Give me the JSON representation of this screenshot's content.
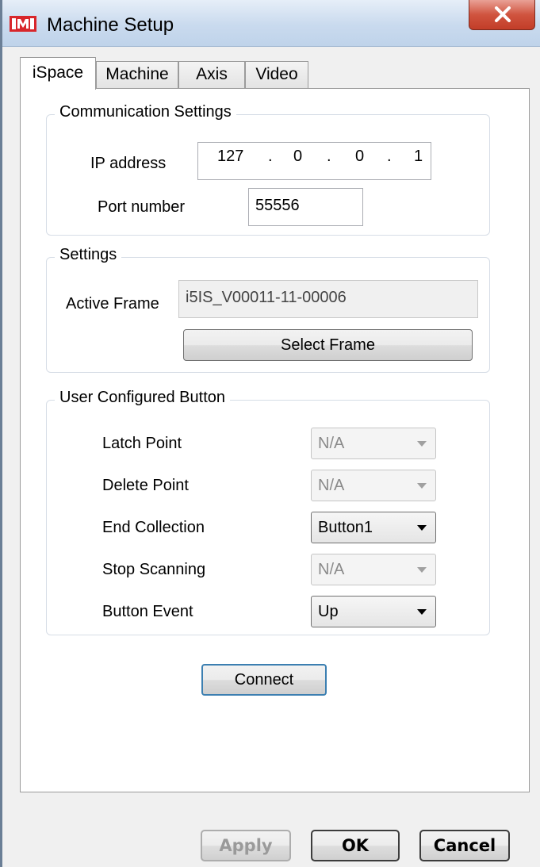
{
  "window": {
    "title": "Machine Setup",
    "icon": "app-logo-icon",
    "close_icon": "close-icon"
  },
  "tabs": [
    {
      "label": "iSpace",
      "active": true
    },
    {
      "label": "Machine",
      "active": false
    },
    {
      "label": "Axis",
      "active": false
    },
    {
      "label": "Video",
      "active": false
    }
  ],
  "communication": {
    "title": "Communication Settings",
    "ip_label": "IP address",
    "ip": {
      "o1": "127",
      "o2": "0",
      "o3": "0",
      "o4": "1"
    },
    "ip_dot": ".",
    "port_label": "Port number",
    "port_value": "55556"
  },
  "settings": {
    "title": "Settings",
    "active_frame_label": "Active Frame",
    "active_frame_value": "i5IS_V00011-11-00006",
    "select_frame_label": "Select Frame"
  },
  "user_button": {
    "title": "User Configured Button",
    "rows": [
      {
        "label": "Latch Point",
        "value": "N/A",
        "enabled": false
      },
      {
        "label": "Delete Point",
        "value": "N/A",
        "enabled": false
      },
      {
        "label": "End Collection",
        "value": "Button1",
        "enabled": true
      },
      {
        "label": "Stop Scanning",
        "value": "N/A",
        "enabled": false
      },
      {
        "label": "Button Event",
        "value": "Up",
        "enabled": true
      }
    ]
  },
  "connect_label": "Connect",
  "footer": {
    "apply": "Apply",
    "ok": "OK",
    "cancel": "Cancel"
  },
  "colors": {
    "title_bar": "#c9daee",
    "close_button": "#c94a36",
    "focus_border": "#3c7fb1"
  }
}
